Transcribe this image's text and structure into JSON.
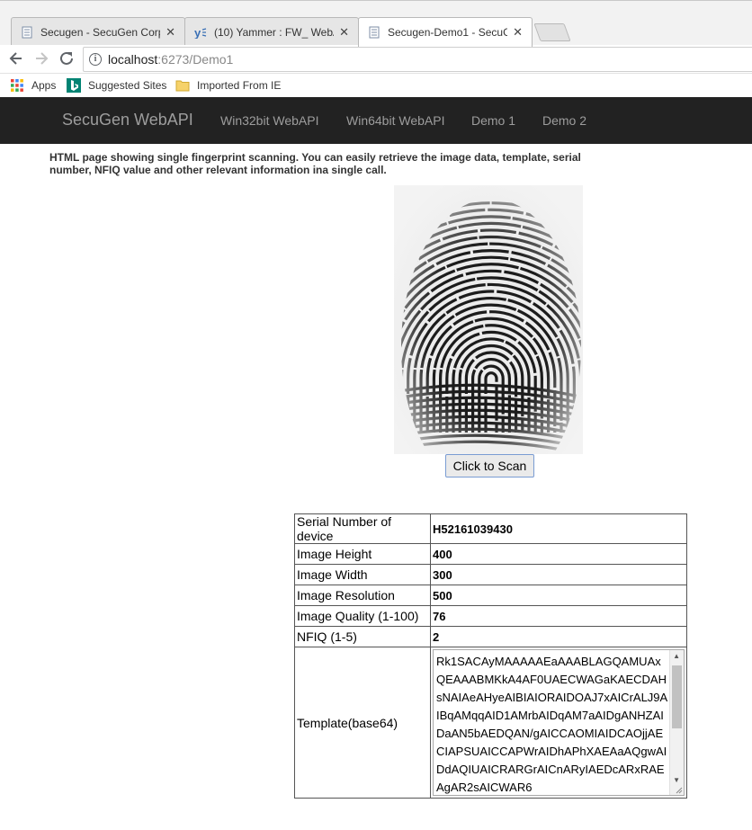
{
  "browser": {
    "tabs": [
      {
        "title": "Secugen - SecuGen Corp",
        "icon": "page-icon"
      },
      {
        "title": "(10) Yammer : FW_ WebA",
        "icon": "yammer-icon"
      },
      {
        "title": "Secugen-Demo1 - SecuG",
        "icon": "page-icon",
        "active": true
      }
    ],
    "url_host": "localhost",
    "url_path": ":6273/Demo1",
    "bookmarks": [
      {
        "label": "Apps",
        "icon": "apps-grid-icon"
      },
      {
        "label": "Suggested Sites",
        "icon": "bing-icon"
      },
      {
        "label": "Imported From IE",
        "icon": "folder-icon"
      }
    ]
  },
  "navbar": {
    "brand": "SecuGen WebAPI",
    "links": [
      "Win32bit WebAPI",
      "Win64bit WebAPI",
      "Demo 1",
      "Demo 2"
    ]
  },
  "intro": "HTML page showing single fingerprint scanning. You can easily retrieve the image data, template, serial number, NFIQ value and other relevant information ina single call.",
  "scan_button": "Click to Scan",
  "info_table": [
    {
      "label": "Serial Number of device",
      "value": "H52161039430"
    },
    {
      "label": "Image Height",
      "value": "400"
    },
    {
      "label": "Image Width",
      "value": "300"
    },
    {
      "label": "Image Resolution",
      "value": "500"
    },
    {
      "label": "Image Quality (1-100)",
      "value": "76"
    },
    {
      "label": "NFIQ (1-5)",
      "value": "2"
    }
  ],
  "template": {
    "label": "Template(base64)",
    "value": "Rk1SACAyMAAAAAEaAAABLAGQAMUAxQEAAABMKkA4AF0UAECWAGaKAECDAHsNAIAeAHyeAIBIAIORAIDOAJ7xAICrALJ9AIBqAMqqAID1AMrbAIDqAM7aAIDgANHZAIDaAN5bAEDQAN/gAICCAOMIAIDCAOjjAECIAPSUAICCAPWrAIDhAPhXAEAaAQgwAIDdAQIUAICRARGrAICnARyIAEDcARxRAEAgAR2sAICWAR6"
  }
}
